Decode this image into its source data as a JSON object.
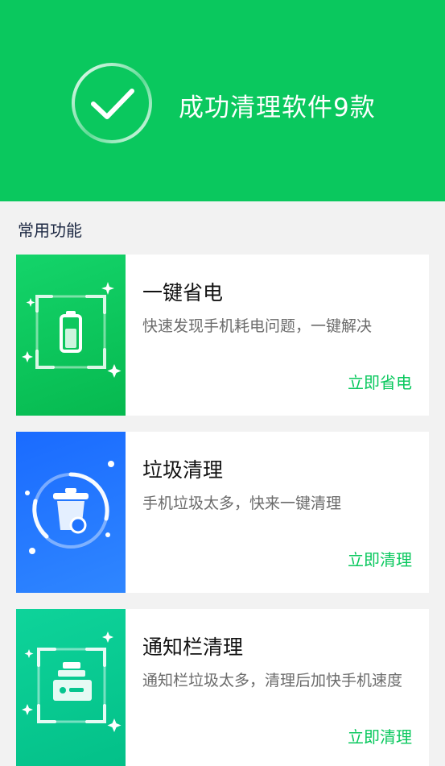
{
  "header": {
    "result_title": "成功清理软件9款",
    "icon": "check-circle-icon",
    "background_color": "#0ac85e"
  },
  "section": {
    "title": "常用功能"
  },
  "features": [
    {
      "title": "一键省电",
      "description": "快速发现手机耗电问题，一键解决",
      "action": "立即省电",
      "icon": "battery-icon",
      "color": "#0ac85e"
    },
    {
      "title": "垃圾清理",
      "description": "手机垃圾太多，快来一键清理",
      "action": "立即清理",
      "icon": "trash-bin-icon",
      "color": "#1f73ff"
    },
    {
      "title": "通知栏清理",
      "description": "通知栏垃圾太多，清理后加快手机速度",
      "action": "立即清理",
      "icon": "notification-tray-icon",
      "color": "#06c58f"
    }
  ],
  "accent_color": "#0ac85e"
}
